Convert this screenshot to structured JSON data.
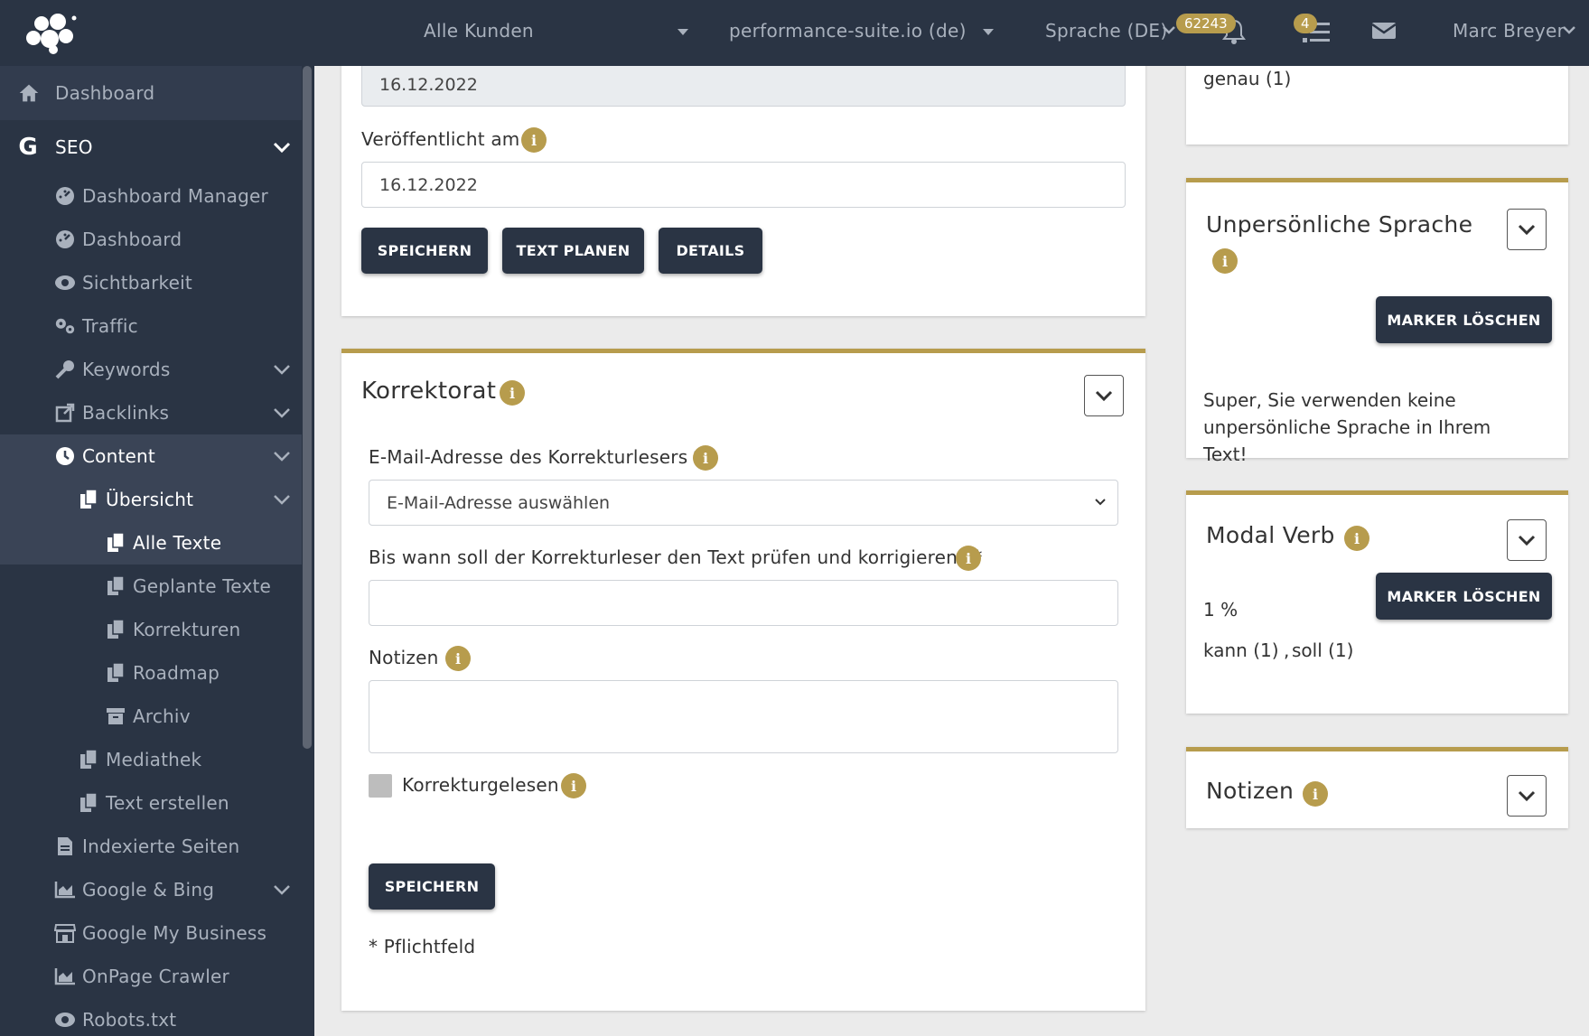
{
  "topbar": {
    "customers": "Alle Kunden",
    "domain": "performance-suite.io (de)",
    "language": "Sprache (DE)",
    "bell_badge": "62243",
    "tasks_badge": "4",
    "user": "Marc Breyer"
  },
  "sidebar": {
    "dashboard": "Dashboard",
    "seo": "SEO",
    "dashboard_manager": "Dashboard Manager",
    "dashboard2": "Dashboard",
    "sichtbarkeit": "Sichtbarkeit",
    "traffic": "Traffic",
    "keywords": "Keywords",
    "backlinks": "Backlinks",
    "content": "Content",
    "uebersicht": "Übersicht",
    "alle_texte": "Alle Texte",
    "geplante_texte": "Geplante Texte",
    "korrekturen": "Korrekturen",
    "roadmap": "Roadmap",
    "archiv": "Archiv",
    "mediathek": "Mediathek",
    "text_erstellen": "Text erstellen",
    "indexierte_seiten": "Indexierte Seiten",
    "google_bing": "Google & Bing",
    "google_my_business": "Google My Business",
    "onpage_crawler": "OnPage Crawler",
    "robots": "Robots.txt"
  },
  "publish_card": {
    "created_value": "16.12.2022",
    "published_label": "Veröffentlicht am",
    "published_value": "16.12.2022",
    "save": "SPEICHERN",
    "plan": "TEXT PLANEN",
    "details": "DETAILS"
  },
  "korrektorat": {
    "title": "Korrektorat",
    "email_label": "E-Mail-Adresse des Korrekturlesers *",
    "email_select": "E-Mail-Adresse auswählen",
    "deadline_label": "Bis wann soll der Korrekturleser den Text prüfen und korrigieren? *",
    "notes_label": "Notizen",
    "proofread_label": "Korrekturgelesen",
    "save": "SPEICHERN",
    "required_note": "* Pflichtfeld"
  },
  "right": {
    "top_link": "genau (1)",
    "impersonal": {
      "title": "Unpersönliche Sprache",
      "clear": "MARKER LÖSCHEN",
      "message": "Super, Sie verwenden keine unpersönliche Sprache in Ihrem Text!"
    },
    "modal": {
      "title": "Modal Verb",
      "clear": "MARKER LÖSCHEN",
      "percent": "1 %",
      "word1": "kann (1)",
      "sep": ",",
      "word2": "soll (1)"
    },
    "notes": {
      "title": "Notizen"
    }
  },
  "colors": {
    "navy": "#2a3444",
    "gold": "#b79c4d",
    "blue_link": "#2b6a9e"
  }
}
